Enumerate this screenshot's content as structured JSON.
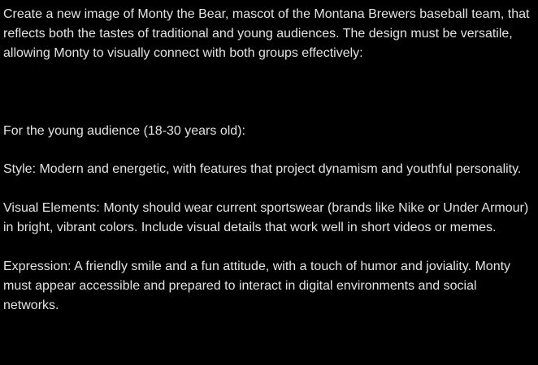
{
  "message": {
    "intro": "Create a new image of Monty the Bear, mascot of the Montana Brewers baseball team, that reflects both the tastes of traditional and young audiences. The design must be versatile, allowing Monty to visually connect with both groups effectively:",
    "young_heading": "For the young audience (18-30 years old):",
    "style": "Style: Modern and energetic, with features that project dynamism and youthful personality.",
    "visual_elements": "Visual Elements: Monty should wear current sportswear (brands like Nike or Under Armour) in bright, vibrant colors. Include visual details that work well in short videos or memes.",
    "expression": "Expression: A friendly smile and a fun attitude, with a touch of humor and joviality. Monty must appear accessible and prepared to interact in digital environments and social networks."
  },
  "colors": {
    "background": "#000000",
    "text": "#e3e3e3"
  }
}
